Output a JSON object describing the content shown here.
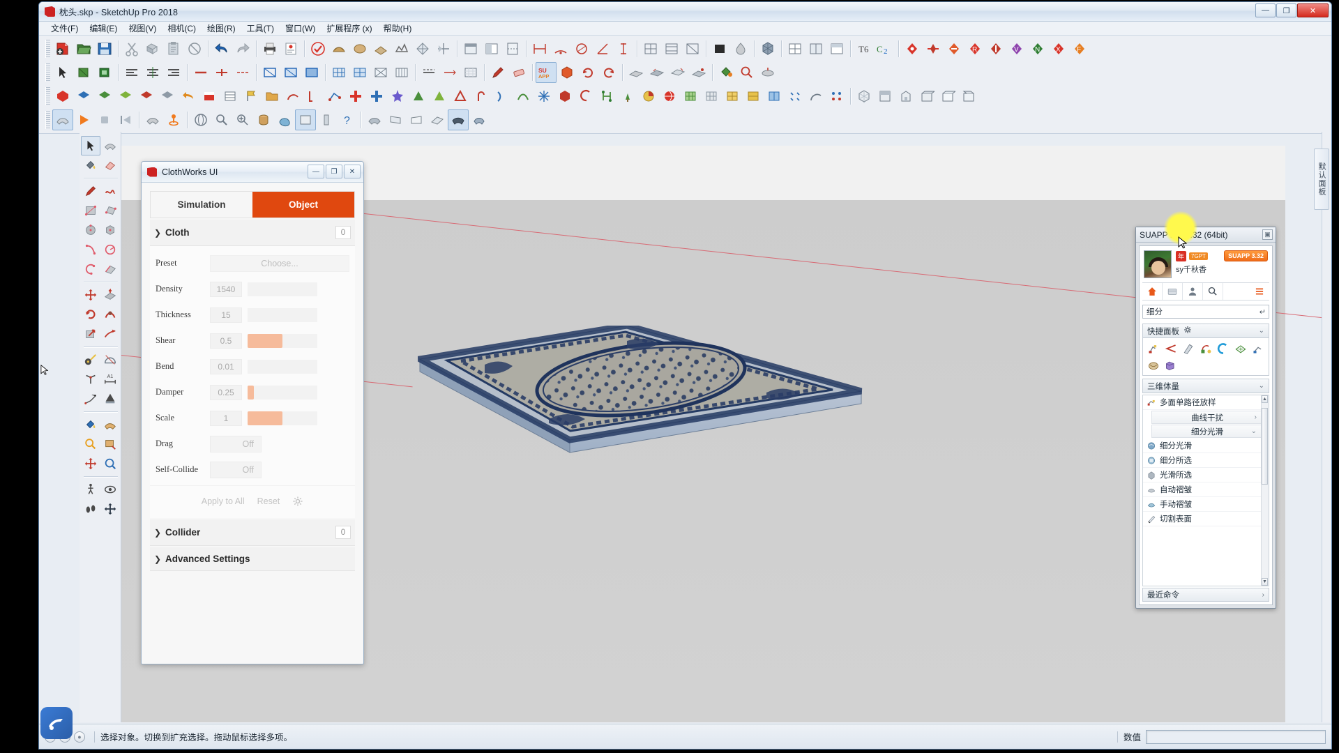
{
  "window": {
    "title": "枕头.skp - SketchUp Pro 2018",
    "minimize": "—",
    "maximize": "❐",
    "close": "✕"
  },
  "menubar": [
    {
      "label": "文件(F)"
    },
    {
      "label": "编辑(E)"
    },
    {
      "label": "视图(V)"
    },
    {
      "label": "相机(C)"
    },
    {
      "label": "绘图(R)"
    },
    {
      "label": "工具(T)"
    },
    {
      "label": "窗口(W)"
    },
    {
      "label": "扩展程序 (x)"
    },
    {
      "label": "帮助(H)"
    }
  ],
  "tray_tab": {
    "label": "默认面板"
  },
  "statusbar": {
    "message": "选择对象。切换到扩充选择。拖动鼠标选择多项。",
    "vcb_label": "数值",
    "vcb_value": ""
  },
  "clothworks": {
    "title": "ClothWorks UI",
    "minimize": "—",
    "restore": "❐",
    "close": "✕",
    "tabs": [
      {
        "label": "Simulation",
        "active": false
      },
      {
        "label": "Object",
        "active": true
      }
    ],
    "sections": [
      {
        "name": "Cloth",
        "count": "0",
        "expanded": true
      },
      {
        "name": "Collider",
        "count": "0",
        "expanded": false
      },
      {
        "name": "Advanced Settings",
        "count": "",
        "expanded": false
      }
    ],
    "accent": "#e0480f",
    "slider_color": "#f6bb9b",
    "params": [
      {
        "label": "Preset",
        "type": "choose",
        "value": "Choose..."
      },
      {
        "label": "Density",
        "type": "slider",
        "value": "1540",
        "fill_pct": 0
      },
      {
        "label": "Thickness",
        "type": "slider",
        "value": "15",
        "fill_pct": 0
      },
      {
        "label": "Shear",
        "type": "slider",
        "value": "0.5",
        "fill_pct": 50
      },
      {
        "label": "Bend",
        "type": "slider",
        "value": "0.01",
        "fill_pct": 0
      },
      {
        "label": "Damper",
        "type": "slider",
        "value": "0.25",
        "fill_pct": 9
      },
      {
        "label": "Scale",
        "type": "slider",
        "value": "1",
        "fill_pct": 50
      },
      {
        "label": "Drag",
        "type": "toggle",
        "value": "Off"
      },
      {
        "label": "Self-Collide",
        "type": "toggle",
        "value": "Off"
      }
    ],
    "actions": {
      "apply_all": "Apply to All",
      "reset": "Reset",
      "settings_icon": "gear-icon"
    }
  },
  "suapp": {
    "title": "SUAPP Pro 3.32 (64bit)",
    "pin": "▣",
    "user": {
      "name": "sy千秋香",
      "tag_year": "年",
      "tag_app": "7GPT",
      "version_badge": "SUAPP 3.32"
    },
    "iconbar": [
      {
        "name": "home-icon",
        "active": true
      },
      {
        "name": "card-icon",
        "active": false
      },
      {
        "name": "person-icon",
        "active": false
      },
      {
        "name": "search-icon",
        "active": false
      },
      {
        "name": "list-menu-icon",
        "active": false
      }
    ],
    "search": {
      "value": "细分",
      "enter": "↵"
    },
    "quick_panel": {
      "label": "快捷面板",
      "gear": "gear-icon",
      "chevron": "⌄"
    },
    "section_3d": {
      "label": "三维体量",
      "chevron": "⌄"
    },
    "list": [
      {
        "label": "多面单路径放样",
        "type": "item"
      },
      {
        "label": "曲线干扰",
        "type": "sub",
        "arrow": "›"
      },
      {
        "label": "细分光滑",
        "type": "sub",
        "arrow": "⌄"
      },
      {
        "label": "细分光滑",
        "type": "item"
      },
      {
        "label": "细分所选",
        "type": "item"
      },
      {
        "label": "光滑所选",
        "type": "item"
      },
      {
        "label": "自动褶皱",
        "type": "item"
      },
      {
        "label": "手动褶皱",
        "type": "item"
      },
      {
        "label": "切割表面",
        "type": "item"
      }
    ],
    "footer": {
      "label": "最近命令",
      "arrow": "›"
    }
  },
  "viewport": {
    "model_name": "pillow-rug-model",
    "background": "#cfcfcf"
  }
}
